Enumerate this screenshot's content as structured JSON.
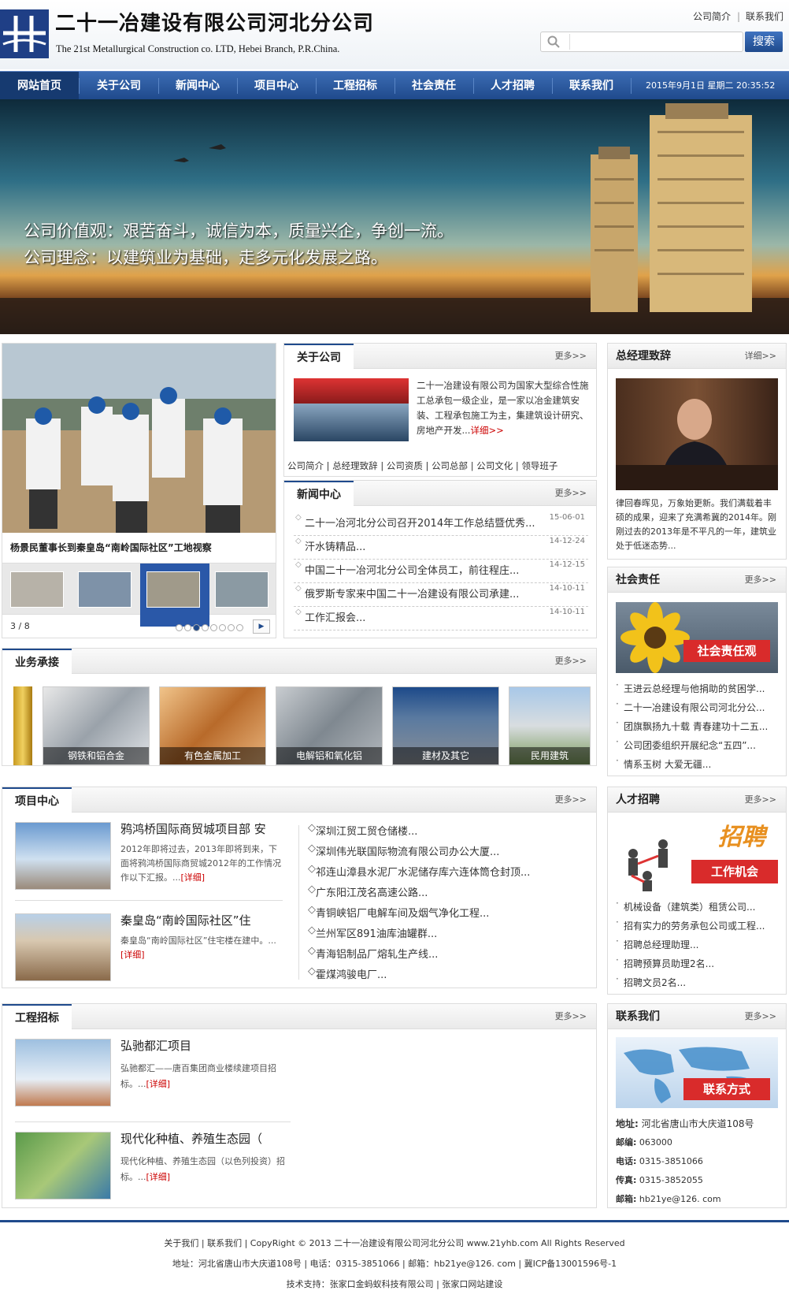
{
  "header": {
    "company_cn": "二十一冶建设有限公司河北分公司",
    "company_en": "The 21st Metallurgical Construction co. LTD, Hebei Branch, P.R.China.",
    "toplinks": [
      "公司简介",
      "联系我们"
    ],
    "search_placeholder": "",
    "search_button": "搜索"
  },
  "nav": {
    "items": [
      "网站首页",
      "关于公司",
      "新闻中心",
      "项目中心",
      "工程招标",
      "社会责任",
      "人才招聘",
      "联系我们"
    ],
    "datetime": "2015年9月1日 星期二 20:35:52"
  },
  "banner": {
    "line1": "公司价值观：艰苦奋斗，诚信为本，质量兴企，争创一流。",
    "line2": "公司理念：以建筑业为基础，走多元化发展之路。"
  },
  "slider": {
    "caption": "杨景民董事长到秦皇岛“南岭国际社区”工地视察",
    "counter": "3 / 8",
    "dot_count": 8,
    "active_dot": 3
  },
  "about": {
    "title": "关于公司",
    "more": "更多>>",
    "text": "二十一冶建设有限公司为国家大型综合性施工总承包一级企业，是一家以冶金建筑安装、工程承包施工为主，集建筑设计研究、房地产开发...",
    "detail": "详细>>",
    "links": [
      "公司简介",
      "总经理致辞",
      "公司资质",
      "公司总部",
      "公司文化",
      "领导班子"
    ]
  },
  "news": {
    "title": "新闻中心",
    "more": "更多>>",
    "items": [
      {
        "title": "二十一冶河北分公司召开2014年工作总结暨优秀...",
        "date": "15-06-01"
      },
      {
        "title": "汗水铸精品...",
        "date": "14-12-24"
      },
      {
        "title": "中国二十一冶河北分公司全体员工，前往程庄...",
        "date": "14-12-15"
      },
      {
        "title": "俄罗斯专家来中国二十一冶建设有限公司承建...",
        "date": "14-10-11"
      },
      {
        "title": "工作汇报会...",
        "date": "14-10-11"
      }
    ]
  },
  "gm": {
    "title": "总经理致辞",
    "more": "详细>>",
    "text": "律回春晖见，万象始更新。我们满载着丰硕的成果，迎来了充满希冀的2014年。刚刚过去的2013年是不平凡的一年，建筑业处于低迷态势..."
  },
  "business": {
    "title": "业务承接",
    "more": "更多>>",
    "items": [
      "钢铁和铝合金",
      "有色金属加工",
      "电解铝和氧化铝",
      "建材及其它",
      "民用建筑"
    ]
  },
  "social": {
    "title": "社会责任",
    "more": "更多>>",
    "banner_text": "社会责任观",
    "items": [
      "王进云总经理与他捐助的贫困学...",
      "二十一冶建设有限公司河北分公...",
      "团旗飘扬九十载 青春建功十二五...",
      "公司团委组织开展纪念“五四”...",
      "情系玉树 大爱无疆..."
    ]
  },
  "projects": {
    "title": "项目中心",
    "more": "更多>>",
    "feature": [
      {
        "title": "鸦鸿桥国际商贸城项目部 安",
        "desc": "2012年即将过去，2013年即将到来，下面将鸦鸿桥国际商贸城2012年的工作情况作以下汇报。...",
        "detail": "[详细]"
      },
      {
        "title": "秦皇岛“南岭国际社区”住",
        "desc": "秦皇岛“南岭国际社区”住宅楼在建中。...",
        "detail": "[详细]"
      }
    ],
    "list": [
      "深圳江贸工贸仓储楼...",
      "深圳伟光联国际物流有限公司办公大厦...",
      "祁连山漳县水泥厂水泥储存库六连体筒仓封顶...",
      "广东阳江茂名高速公路...",
      "青铜峡铝厂电解车间及烟气净化工程...",
      "兰州军区891油库油罐群...",
      "青海铝制品厂熔轧生产线...",
      "霍煤鸿骏电厂..."
    ]
  },
  "jobs": {
    "title": "人才招聘",
    "more": "更多>>",
    "banner_text": "工作机会",
    "banner_big": "招聘",
    "items": [
      "机械设备（建筑类）租赁公司...",
      "招有实力的劳务承包公司或工程...",
      "招聘总经理助理...",
      "招聘预算员助理2名...",
      "招聘文员2名..."
    ]
  },
  "tender": {
    "title": "工程招标",
    "more": "更多>>",
    "items": [
      {
        "title": "弘驰都汇项目",
        "desc": "弘驰都汇——唐百集团商业楼续建项目招标。...",
        "detail": "[详细]"
      },
      {
        "title": "现代化种植、养殖生态园（",
        "desc": "现代化种植、养殖生态园（以色列投资）招标。...",
        "detail": "[详细]"
      }
    ]
  },
  "contact": {
    "title": "联系我们",
    "more": "更多>>",
    "banner_text": "联系方式",
    "rows": [
      {
        "k": "地址:",
        "v": "河北省唐山市大庆道108号"
      },
      {
        "k": "邮编:",
        "v": "063000"
      },
      {
        "k": "电话:",
        "v": "0315-3851066"
      },
      {
        "k": "传真:",
        "v": "0315-3852055"
      },
      {
        "k": "邮箱:",
        "v": "hb21ye@126. com"
      }
    ]
  },
  "footer": {
    "line1": "关于我们 | 联系我们 | CopyRight © 2013 二十一冶建设有限公司河北分公司 www.21yhb.com All Rights Reserved",
    "line2": "地址：河北省唐山市大庆道108号 | 电话：0315-3851066 | 邮箱：hb21ye@126. com | 冀ICP备13001596号-1",
    "line3": "技术支持：张家口金蚂蚁科技有限公司 | 张家口网站建设"
  }
}
